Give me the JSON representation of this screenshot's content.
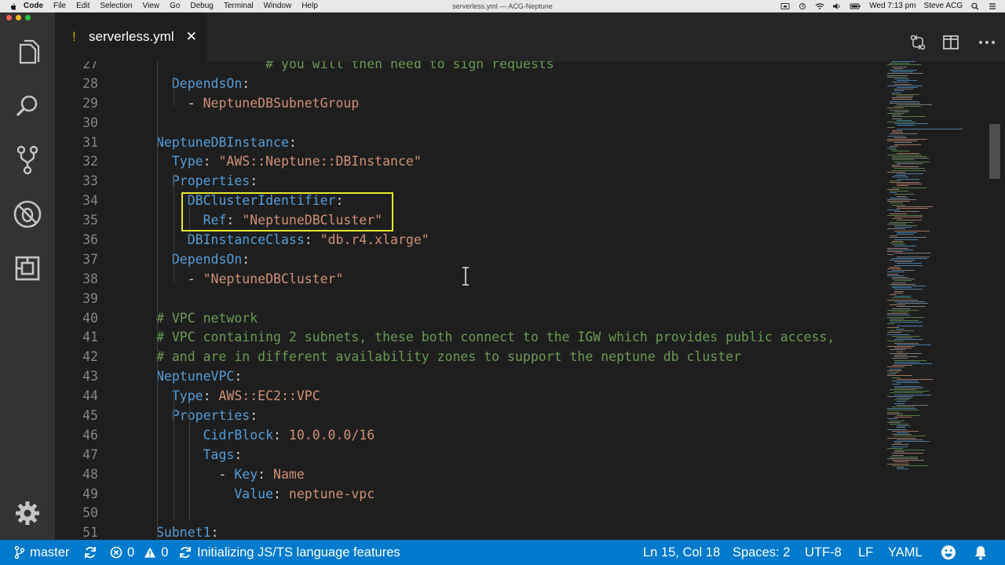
{
  "menubar": {
    "app": "Code",
    "items": [
      "File",
      "Edit",
      "Selection",
      "View",
      "Go",
      "Debug",
      "Terminal",
      "Window",
      "Help"
    ],
    "window_title": "serverless.yml — ACG-Neptune",
    "clock": "Wed 7:13 pm",
    "user": "Steve ACG"
  },
  "tab": {
    "modified_marker": "!",
    "filename": "serverless.yml",
    "close": "✕"
  },
  "editor": {
    "lines": [
      {
        "n": "27",
        "indent": 0,
        "parts": [
          {
            "t": "              # you will then need to sign requests",
            "c": "c"
          }
        ]
      },
      {
        "n": "28",
        "indent": 0,
        "parts": [
          {
            "t": "  ",
            "c": "p"
          },
          {
            "t": "DependsOn",
            "c": "k"
          },
          {
            "t": ":",
            "c": "p"
          }
        ]
      },
      {
        "n": "29",
        "indent": 0,
        "parts": [
          {
            "t": "    - ",
            "c": "p"
          },
          {
            "t": "NeptuneDBSubnetGroup",
            "c": "s"
          }
        ]
      },
      {
        "n": "30",
        "indent": 0,
        "parts": []
      },
      {
        "n": "31",
        "indent": 0,
        "parts": [
          {
            "t": "NeptuneDBInstance",
            "c": "k"
          },
          {
            "t": ":",
            "c": "p"
          }
        ]
      },
      {
        "n": "32",
        "indent": 0,
        "parts": [
          {
            "t": "  ",
            "c": "p"
          },
          {
            "t": "Type",
            "c": "k"
          },
          {
            "t": ": ",
            "c": "p"
          },
          {
            "t": "\"AWS::Neptune::DBInstance\"",
            "c": "s"
          }
        ]
      },
      {
        "n": "33",
        "indent": 0,
        "parts": [
          {
            "t": "  ",
            "c": "p"
          },
          {
            "t": "Properties",
            "c": "k"
          },
          {
            "t": ":",
            "c": "p"
          }
        ]
      },
      {
        "n": "34",
        "indent": 0,
        "parts": [
          {
            "t": "    ",
            "c": "p"
          },
          {
            "t": "DBClusterIdentifier",
            "c": "k"
          },
          {
            "t": ":",
            "c": "p"
          }
        ]
      },
      {
        "n": "35",
        "indent": 0,
        "parts": [
          {
            "t": "      ",
            "c": "p"
          },
          {
            "t": "Ref",
            "c": "k"
          },
          {
            "t": ": ",
            "c": "p"
          },
          {
            "t": "\"NeptuneDBCluster\"",
            "c": "s"
          }
        ]
      },
      {
        "n": "36",
        "indent": 0,
        "parts": [
          {
            "t": "    ",
            "c": "p"
          },
          {
            "t": "DBInstanceClass",
            "c": "k"
          },
          {
            "t": ": ",
            "c": "p"
          },
          {
            "t": "\"db.r4.xlarge\"",
            "c": "s"
          }
        ]
      },
      {
        "n": "37",
        "indent": 0,
        "parts": [
          {
            "t": "  ",
            "c": "p"
          },
          {
            "t": "DependsOn",
            "c": "k"
          },
          {
            "t": ":",
            "c": "p"
          }
        ]
      },
      {
        "n": "38",
        "indent": 0,
        "parts": [
          {
            "t": "    - ",
            "c": "p"
          },
          {
            "t": "\"NeptuneDBCluster\"",
            "c": "s"
          }
        ]
      },
      {
        "n": "39",
        "indent": 0,
        "parts": []
      },
      {
        "n": "40",
        "indent": 0,
        "parts": [
          {
            "t": "# VPC network",
            "c": "c"
          }
        ]
      },
      {
        "n": "41",
        "indent": 0,
        "parts": [
          {
            "t": "# VPC containing 2 subnets, these both connect to the IGW which provides public access,",
            "c": "c"
          }
        ]
      },
      {
        "n": "42",
        "indent": 0,
        "parts": [
          {
            "t": "# and are in different availability zones to support the neptune db cluster",
            "c": "c"
          }
        ]
      },
      {
        "n": "43",
        "indent": 0,
        "parts": [
          {
            "t": "NeptuneVPC",
            "c": "k"
          },
          {
            "t": ":",
            "c": "p"
          }
        ]
      },
      {
        "n": "44",
        "indent": 0,
        "parts": [
          {
            "t": "  ",
            "c": "p"
          },
          {
            "t": "Type",
            "c": "k"
          },
          {
            "t": ": ",
            "c": "p"
          },
          {
            "t": "AWS::EC2::VPC",
            "c": "s"
          }
        ]
      },
      {
        "n": "45",
        "indent": 0,
        "parts": [
          {
            "t": "  ",
            "c": "p"
          },
          {
            "t": "Properties",
            "c": "k"
          },
          {
            "t": ":",
            "c": "p"
          }
        ]
      },
      {
        "n": "46",
        "indent": 0,
        "parts": [
          {
            "t": "      ",
            "c": "p"
          },
          {
            "t": "CidrBlock",
            "c": "k"
          },
          {
            "t": ": ",
            "c": "p"
          },
          {
            "t": "10.0.0.0/16",
            "c": "s"
          }
        ]
      },
      {
        "n": "47",
        "indent": 0,
        "parts": [
          {
            "t": "      ",
            "c": "p"
          },
          {
            "t": "Tags",
            "c": "k"
          },
          {
            "t": ":",
            "c": "p"
          }
        ]
      },
      {
        "n": "48",
        "indent": 0,
        "parts": [
          {
            "t": "        - ",
            "c": "p"
          },
          {
            "t": "Key",
            "c": "k"
          },
          {
            "t": ": ",
            "c": "p"
          },
          {
            "t": "Name",
            "c": "s"
          }
        ]
      },
      {
        "n": "49",
        "indent": 0,
        "parts": [
          {
            "t": "          ",
            "c": "p"
          },
          {
            "t": "Value",
            "c": "k"
          },
          {
            "t": ": ",
            "c": "p"
          },
          {
            "t": "neptune-vpc",
            "c": "s"
          }
        ]
      },
      {
        "n": "50",
        "indent": 0,
        "parts": []
      },
      {
        "n": "51",
        "indent": 0,
        "parts": [
          {
            "t": "Subnet1",
            "c": "k"
          },
          {
            "t": ":",
            "c": "p"
          }
        ]
      }
    ]
  },
  "statusbar": {
    "branch": "master",
    "errors": "0",
    "warnings": "0",
    "task": "Initializing JS/TS language features",
    "position": "Ln 15, Col 18",
    "spaces": "Spaces: 2",
    "encoding": "UTF-8",
    "eol": "LF",
    "language": "YAML"
  },
  "colors": {
    "statusbar": "#007acc",
    "keyword": "#569cd6",
    "string": "#ce9178",
    "comment": "#6a9955",
    "highlight_box": "#e6e62e"
  }
}
